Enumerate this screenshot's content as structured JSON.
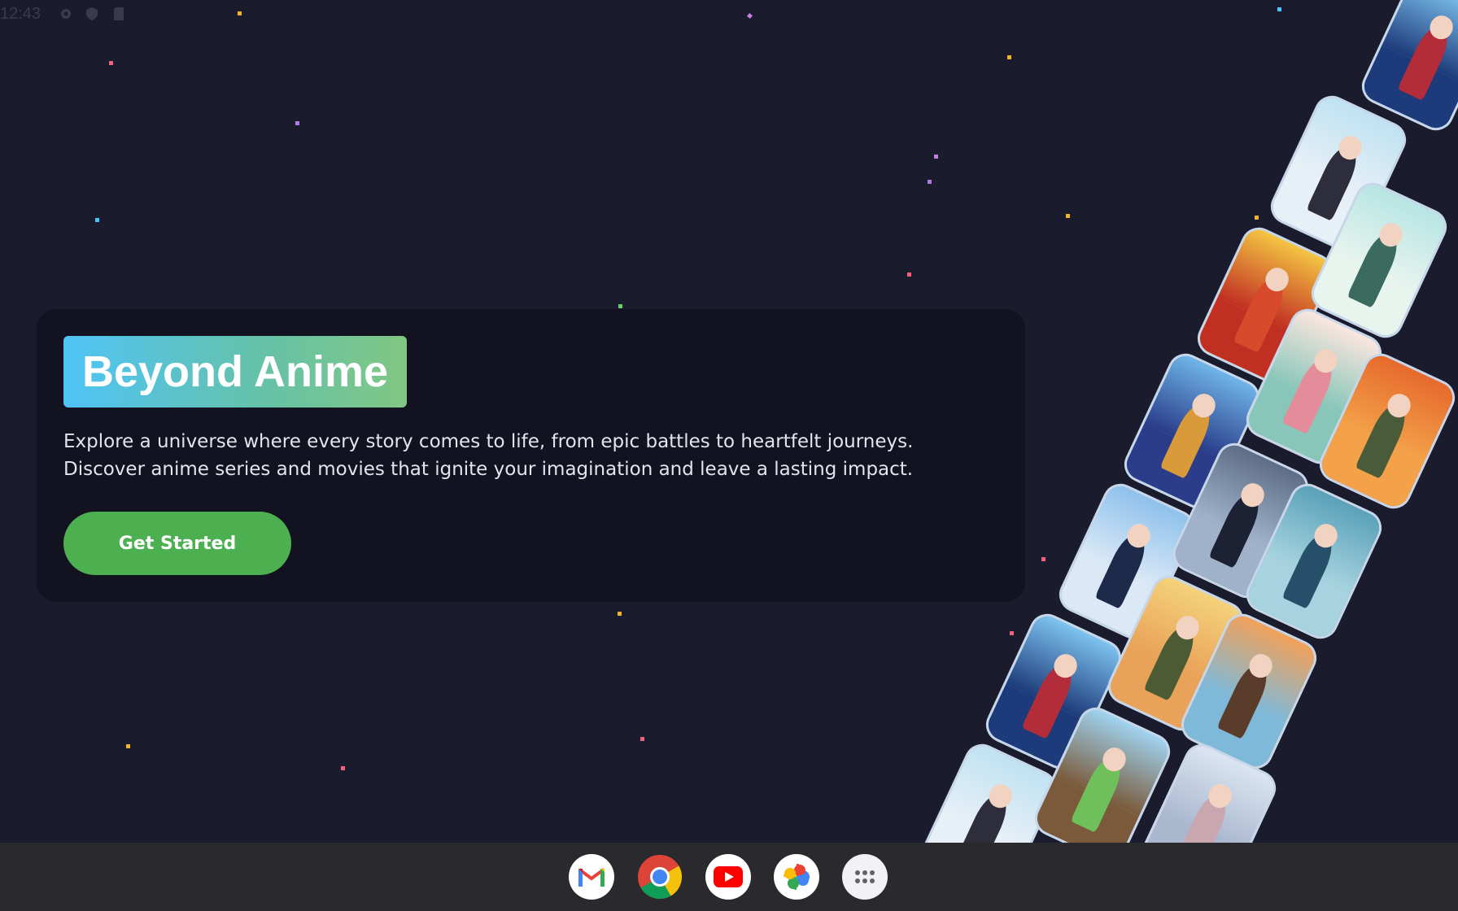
{
  "status_bar": {
    "time": "12:43",
    "left_icons": [
      "settings-icon",
      "shield-icon",
      "sd-card-icon"
    ],
    "right_icons": [
      "wifi-icon",
      "signal-icon",
      "battery-icon"
    ]
  },
  "hero": {
    "title": "Beyond Anime",
    "description": "Explore a universe where every story comes to life, from epic battles to heartfelt journeys. Discover anime series and movies that ignite your imagination and leave a lasting impact.",
    "cta_label": "Get Started"
  },
  "posters": [
    {
      "name": "poster-soccer-player-41",
      "colors": [
        "#7ec3ef",
        "#b32c3a",
        "#1d3b7a"
      ]
    },
    {
      "name": "poster-schoolgirl-studying",
      "colors": [
        "#bfe2f2",
        "#2d2d3c",
        "#e8f0f7"
      ]
    },
    {
      "name": "poster-red-haired-boy",
      "colors": [
        "#f4c542",
        "#d84a2b",
        "#c12f23"
      ]
    },
    {
      "name": "poster-lab-boy",
      "colors": [
        "#b7e5e3",
        "#3b6b5e",
        "#e8f4ee"
      ]
    },
    {
      "name": "poster-motorcycle-chase",
      "colors": [
        "#6fb5e8",
        "#d99a3a",
        "#2a3c8a"
      ]
    },
    {
      "name": "poster-stacked-cats",
      "colors": [
        "#fbe6df",
        "#e58c9a",
        "#87c6b9"
      ]
    },
    {
      "name": "poster-officer-sunset",
      "colors": [
        "#e66a2c",
        "#4a5b3a",
        "#f3a24a"
      ]
    },
    {
      "name": "poster-pilot-uniform",
      "colors": [
        "#8ec1ec",
        "#1e2a4a",
        "#dbe9f6"
      ]
    },
    {
      "name": "poster-gothic-girl",
      "colors": [
        "#5d6d86",
        "#1c2233",
        "#9fb2c9"
      ]
    },
    {
      "name": "poster-boy-in-corridor",
      "colors": [
        "#5aa1b8",
        "#26506a",
        "#a6d3df"
      ]
    },
    {
      "name": "poster-soccer-player-41-b",
      "colors": [
        "#7ec3ef",
        "#b32c3a",
        "#1d3b7a"
      ]
    },
    {
      "name": "poster-paratrooper",
      "colors": [
        "#f4d27a",
        "#4c5b33",
        "#e9a25a"
      ]
    },
    {
      "name": "poster-burning-tower",
      "colors": [
        "#f2a15a",
        "#5a3c2a",
        "#7fb9d9"
      ]
    },
    {
      "name": "poster-schoolgirl-b",
      "colors": [
        "#bfe2f2",
        "#2d2d3c",
        "#e8f0f7"
      ]
    },
    {
      "name": "poster-valley-boy",
      "colors": [
        "#9fd3f0",
        "#6fbf5a",
        "#7a5a3a"
      ]
    },
    {
      "name": "poster-silver-haired-girl",
      "colors": [
        "#dbe5f2",
        "#c9a7b0",
        "#aab8cf"
      ]
    }
  ],
  "dock": {
    "apps": [
      {
        "name": "gmail-icon",
        "label": "Gmail"
      },
      {
        "name": "chrome-icon",
        "label": "Chrome"
      },
      {
        "name": "youtube-icon",
        "label": "YouTube"
      },
      {
        "name": "photos-icon",
        "label": "Photos"
      },
      {
        "name": "app-drawer-icon",
        "label": "All apps"
      }
    ]
  },
  "colors": {
    "background": "#1b1b2e",
    "card": "#121220",
    "accent_green": "#4caf50",
    "badge_gradient_start": "#4fc3f7",
    "badge_gradient_end": "#81c784"
  }
}
